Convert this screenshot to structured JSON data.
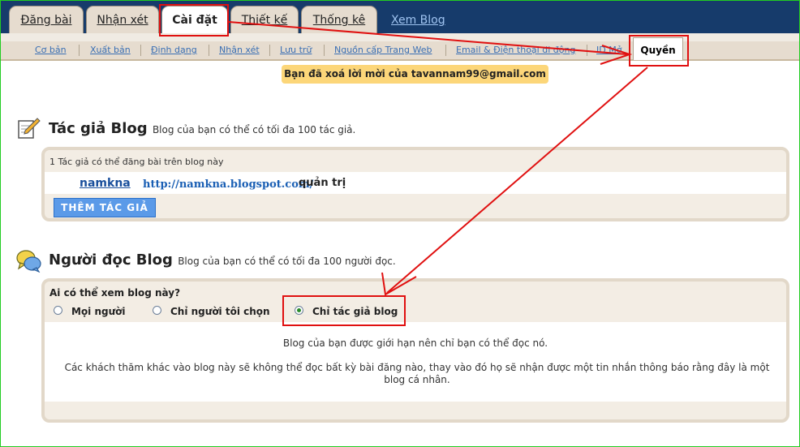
{
  "tabs": {
    "posting": "Đăng bài",
    "comments": "Nhận xét",
    "settings": "Cài đặt",
    "design": "Thiết kế",
    "stats": "Thống kê",
    "view_blog": "Xem Blog"
  },
  "subnav": {
    "basic": "Cơ bản",
    "publishing": "Xuất bản",
    "formatting": "Định dạng",
    "comments": "Nhận xét",
    "archiving": "Lưu trữ",
    "site_feed": "Nguồn cấp Trang Web",
    "email_mobile": "Email & Điện thoại di động",
    "openid": "ID Mở",
    "permissions": "Quyền"
  },
  "message": "Bạn đã xoá lời mời của tavannam99@gmail.com",
  "authors": {
    "title": "Tác giả Blog",
    "subtitle": "Blog của bạn có thể có tối đa 100 tác giả.",
    "header": "1 Tác giả có thể đăng bài trên blog này",
    "rows": [
      {
        "name": "namkna",
        "url": "http://namkna.blogspot.com/",
        "role": "quản trị"
      }
    ],
    "add_button": "THÊM TÁC GIẢ"
  },
  "readers": {
    "title": "Người đọc Blog",
    "subtitle": "Blog của bạn có thể có tối đa 100 người đọc.",
    "question": "Ai có thể xem blog này?",
    "options": [
      "Mọi người",
      "Chỉ người tôi chọn",
      "Chỉ tác giả blog"
    ],
    "selected": "Chỉ tác giả blog",
    "note1": "Blog của bạn được giới hạn nên chỉ bạn có thể đọc nó.",
    "note2": "Các khách thăm khác vào blog này sẽ không thể đọc bất kỳ bài đăng nào, thay vào đó họ sẽ nhận được một tin nhắn thông báo rằng đây là một blog cá nhân."
  },
  "colors": {
    "topbar": "#163b6b",
    "tab_bg": "#e6dccf",
    "message_bg": "#fcd679",
    "button": "#5b9ae8",
    "annotation": "#e01010",
    "link": "#1a5fb4"
  }
}
